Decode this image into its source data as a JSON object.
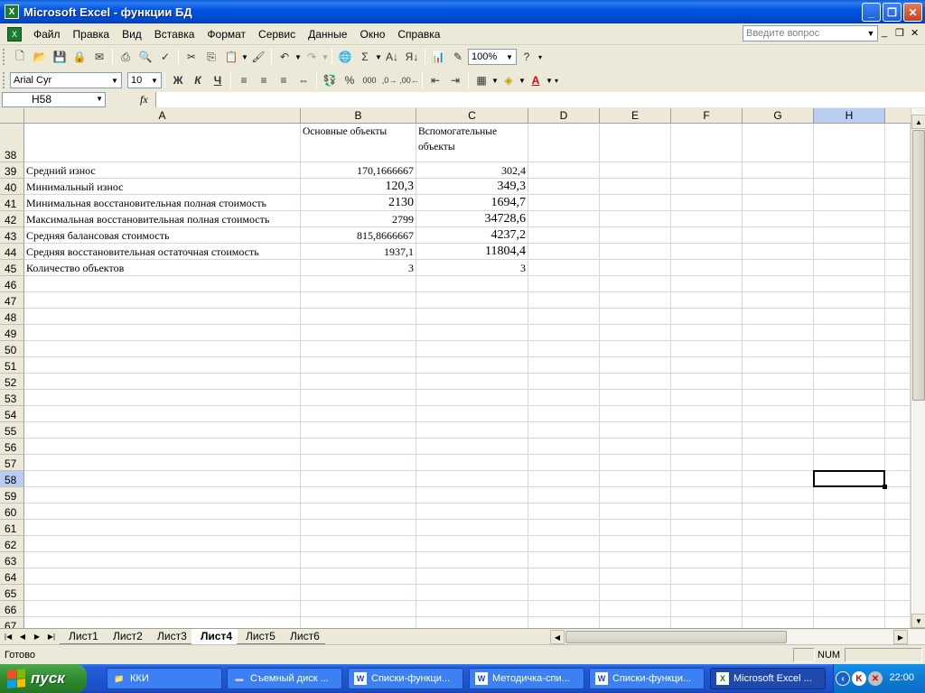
{
  "window": {
    "title": "Microsoft Excel - функции БД",
    "app_icon": "excel-icon"
  },
  "menu": {
    "items": [
      "Файл",
      "Правка",
      "Вид",
      "Вставка",
      "Формат",
      "Сервис",
      "Данные",
      "Окно",
      "Справка"
    ],
    "ask_placeholder": "Введите вопрос"
  },
  "toolbar": {
    "zoom": "100%",
    "font_name": "Arial Cyr",
    "font_size": "10",
    "bold": "Ж",
    "italic": "К",
    "underline": "Ч"
  },
  "formula_bar": {
    "name_box": "H58",
    "fx": "fx",
    "formula": ""
  },
  "grid": {
    "columns": [
      "A",
      "B",
      "C",
      "D",
      "E",
      "F",
      "G",
      "H"
    ],
    "selected_column": "H",
    "selected_row": "58",
    "active_cell": "H58",
    "header_row": {
      "num": "38",
      "b": "Основные объекты",
      "c": "Вспомогательные объекты"
    },
    "data_rows": [
      {
        "num": "39",
        "a": "Средний износ",
        "b": "170,1666667",
        "c": "302,4",
        "bsize": "small",
        "csize": "small"
      },
      {
        "num": "40",
        "a": "Минимальный износ",
        "b": "120,3",
        "c": "349,3",
        "bsize": "large",
        "csize": "large"
      },
      {
        "num": "41",
        "a": "Минимальная восстановительная полная стоимость",
        "b": "2130",
        "c": "1694,7",
        "bsize": "large",
        "csize": "large"
      },
      {
        "num": "42",
        "a": "Максимальная восстановительная полная стоимость",
        "b": "2799",
        "c": "34728,6",
        "bsize": "small",
        "csize": "large"
      },
      {
        "num": "43",
        "a": "Средняя балансовая стоимость",
        "b": "815,8666667",
        "c": "4237,2",
        "bsize": "small",
        "csize": "large"
      },
      {
        "num": "44",
        "a": "Средняя восстановительная остаточная стоимость",
        "b": "1937,1",
        "c": "11804,4",
        "bsize": "small",
        "csize": "large"
      },
      {
        "num": "45",
        "a": "Количество объектов",
        "b": "3",
        "c": "3",
        "bsize": "small",
        "csize": "small"
      }
    ],
    "empty_rows": [
      "46",
      "47",
      "48",
      "49",
      "50",
      "51",
      "52",
      "53",
      "54",
      "55",
      "56",
      "57",
      "58",
      "59",
      "60",
      "61",
      "62",
      "63",
      "64",
      "65",
      "66",
      "67"
    ]
  },
  "sheets": {
    "tabs": [
      "Лист1",
      "Лист2",
      "Лист3",
      "Лист4",
      "Лист5",
      "Лист6"
    ],
    "active": "Лист4"
  },
  "status": {
    "text": "Готово",
    "num": "NUM"
  },
  "taskbar": {
    "start": "пуск",
    "items": [
      {
        "label": "ККИ",
        "icon": "folder-icon"
      },
      {
        "label": "Съемный диск ...",
        "icon": "drive-icon"
      },
      {
        "label": "Списки-функци...",
        "icon": "word-icon"
      },
      {
        "label": "Методичка-спи...",
        "icon": "word-icon"
      },
      {
        "label": "Списки-функци...",
        "icon": "word-icon"
      },
      {
        "label": "Microsoft Excel ...",
        "icon": "excel-icon"
      }
    ],
    "active_index": 5,
    "clock": "22:00"
  },
  "colors": {
    "title_bar": "#0055e5",
    "selection_header": "#b8cdf0",
    "taskbar": "#245edb",
    "start_button": "#2f8b2f"
  }
}
